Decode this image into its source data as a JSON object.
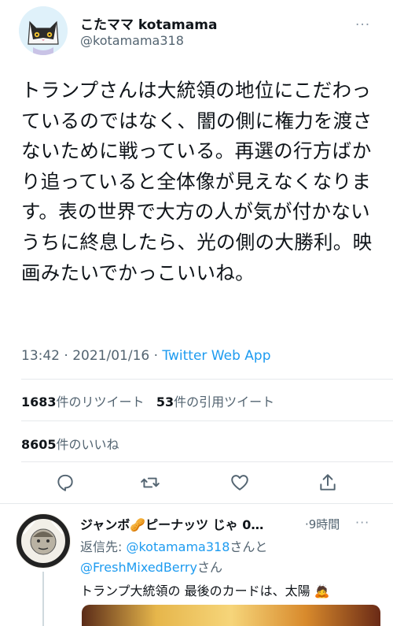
{
  "tweet": {
    "display_name": "こたママ kotamama",
    "handle": "@kotamama318",
    "more_label": "···",
    "text": "トランプさんは大統領の地位にこだわっているのではなく、闇の側に権力を渡さないために戦っている。再選の行方ばかり追っていると全体像が見えなくなります。表の世界で大方の人が気が付かないうちに終息したら、光の側の大勝利。映画みたいでかっこいいね。",
    "time": "13:42",
    "date": "2021/01/16",
    "separator": " · ",
    "client": "Twitter Web App",
    "retweet_count": "1683",
    "retweet_label": "件のリツイート",
    "quote_count": "53",
    "quote_label": "件の引用ツイート",
    "like_count": "8605",
    "like_label": "件のいいね"
  },
  "actions": {
    "reply_icon": "reply-icon",
    "retweet_icon": "retweet-icon",
    "like_icon": "heart-icon",
    "share_icon": "share-icon"
  },
  "reply": {
    "display_name": "ジャンボ🥜ピーナッツ じゃ 0…",
    "time": "·9時間",
    "more_label": "···",
    "reply_to_prefix": "返信先: ",
    "mention1": "@kotamama318",
    "mention_joiner": "さんと",
    "mention2": "@FreshMixedBerry",
    "mention_suffix": "さん",
    "text": "トランプ大統領の 最後のカードは、太陽 🙇"
  },
  "colors": {
    "accent": "#1d9bf0",
    "secondary_text": "#536471"
  }
}
